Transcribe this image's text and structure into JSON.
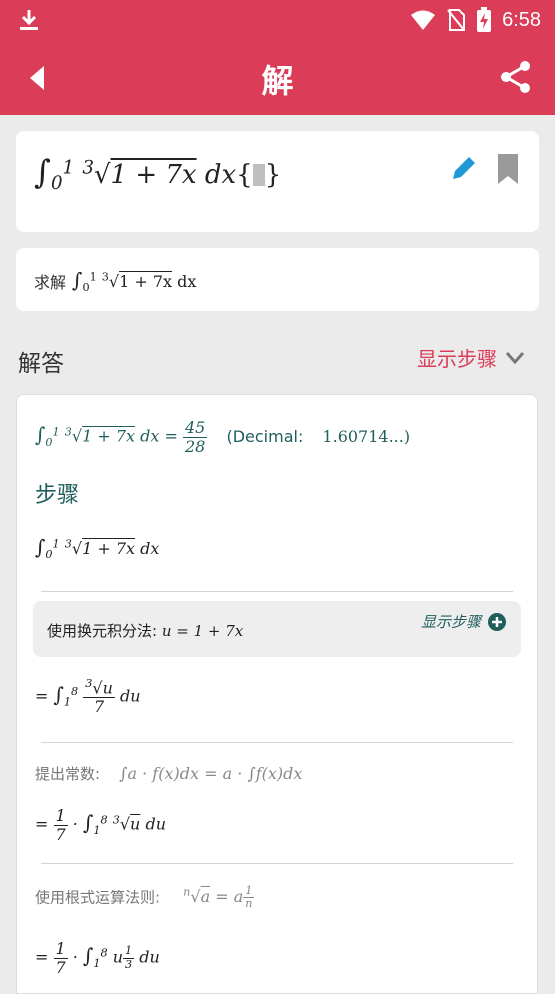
{
  "status_bar": {
    "time": "6:58"
  },
  "app_bar": {
    "title": "解"
  },
  "input": {
    "integral_lower": "0",
    "integral_upper": "1",
    "root_index": "3",
    "radicand": "1 + 7x",
    "differential": "dx",
    "brace_open": "{",
    "brace_close": "}"
  },
  "query": {
    "prefix": "求解",
    "integral_lower": "0",
    "integral_upper": "1",
    "root_index": "3",
    "radicand": "1 + 7x",
    "differential": "dx"
  },
  "answer": {
    "label": "解答",
    "show_steps": "显示步骤",
    "result_num": "45",
    "result_den": "28",
    "decimal_label": "(Decimal:",
    "decimal_value": "1.60714...)"
  },
  "steps": {
    "title": "步骤",
    "method_label": "使用换元积分法:",
    "method_math": "u = 1 + 7x",
    "method_show": "显示步骤",
    "sub_lower": "1",
    "sub_upper": "8",
    "sub_num_var": "u",
    "sub_den": "7",
    "sub_diff": "du",
    "rule1_label": "提出常数:",
    "rule1_math": "∫a · f(x)dx = a · ∫f(x)dx",
    "const_num": "1",
    "const_den": "7",
    "rule2_label": "使用根式运算法则:",
    "rule2_index": "n",
    "rule2_var": "a",
    "rule2_rhs": "= a",
    "rule2_exp_num": "1",
    "rule2_exp_den": "n",
    "exp_num": "1",
    "exp_den": "3"
  }
}
